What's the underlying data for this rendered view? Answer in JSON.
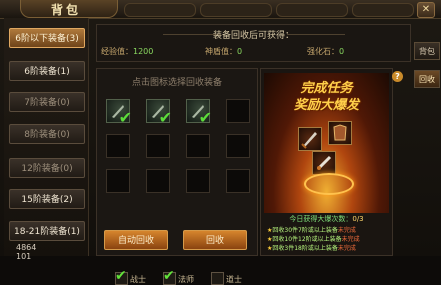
{
  "window": {
    "title": "背包"
  },
  "sidebar": {
    "items": [
      {
        "label": "6阶以下装备(3)"
      },
      {
        "label": "6阶装备(1)"
      },
      {
        "label": "7阶装备(0)"
      },
      {
        "label": "8阶装备(0)"
      },
      {
        "label": "12阶装备(0)"
      },
      {
        "label": "15阶装备(2)"
      },
      {
        "label": "18-21阶装备(1)"
      }
    ],
    "bottom_values": [
      "4864",
      "101"
    ]
  },
  "info": {
    "title": "装备回收后可获得：",
    "exp_label": "经验值：",
    "exp_value": "1200",
    "shield_label": "神盾值：",
    "shield_value": "0",
    "stone_label": "强化石：",
    "stone_value": "0"
  },
  "grid": {
    "title": "点击图标选择回收装备",
    "cells_filled": [
      true,
      true,
      true,
      false,
      false,
      false,
      false,
      false,
      false,
      false,
      false,
      false
    ],
    "cells_checked": [
      true,
      true,
      true,
      false,
      false,
      false,
      false,
      false,
      false,
      false,
      false,
      false
    ]
  },
  "filters": [
    {
      "label": "战士",
      "checked": true
    },
    {
      "label": "法师",
      "checked": true
    },
    {
      "label": "道士",
      "checked": false
    }
  ],
  "buttons": {
    "auto_recycle": "自动回收",
    "recycle": "回收"
  },
  "reward": {
    "title_line1": "完成任务",
    "title_line2": "奖励大爆发",
    "count_label": "今日获得大爆次数：",
    "count_value": "0/3",
    "lines": [
      {
        "text": "回收30件7阶或以上装备",
        "status": "未完成"
      },
      {
        "text": "回收10件12阶或以上装备",
        "status": "未完成"
      },
      {
        "text": "回收3件18阶或以上装备",
        "status": "未完成"
      }
    ]
  },
  "right_tabs": [
    {
      "label": "背包"
    },
    {
      "label": "回收"
    }
  ],
  "help_icon": "?",
  "close_icon": "✕"
}
